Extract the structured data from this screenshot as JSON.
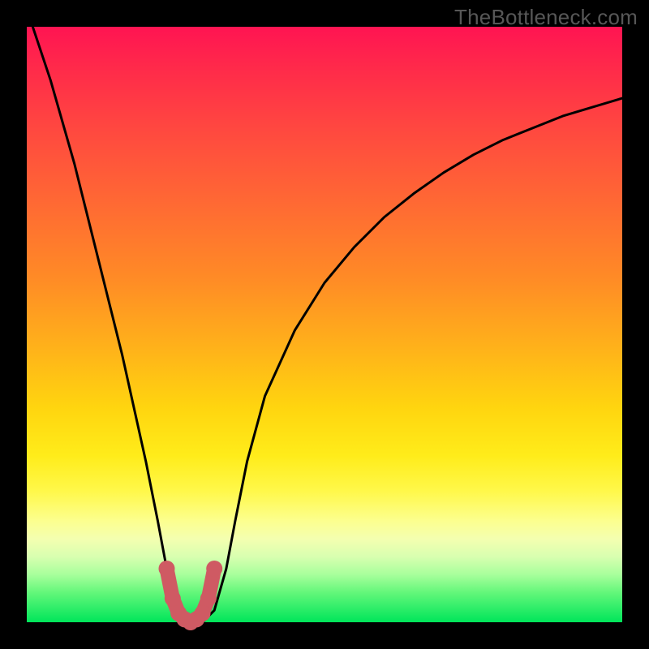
{
  "watermark": "TheBottleneck.com",
  "colors": {
    "frame_bg": "#000000",
    "curve_stroke": "#000000",
    "marker_stroke": "#cf5a63",
    "marker_fill": "#cf5a63",
    "gradient_top": "#ff1452",
    "gradient_bottom": "#00e55a"
  },
  "chart_data": {
    "type": "line",
    "title": "",
    "xlabel": "",
    "ylabel": "",
    "xlim": [
      0,
      100
    ],
    "ylim": [
      0,
      100
    ],
    "grid": false,
    "legend": false,
    "series": [
      {
        "name": "main-curve",
        "x": [
          0,
          2,
          4,
          6,
          8,
          10,
          12,
          14,
          16,
          18,
          20,
          22,
          23.5,
          25.5,
          27.5,
          29.5,
          31.5,
          33.5,
          35,
          37,
          40,
          45,
          50,
          55,
          60,
          65,
          70,
          75,
          80,
          85,
          90,
          95,
          100
        ],
        "values": [
          103,
          97,
          91,
          84,
          77,
          69,
          61,
          53,
          45,
          36,
          27,
          17,
          9,
          2,
          0,
          0,
          2,
          9,
          17,
          27,
          38,
          49,
          57,
          63,
          68,
          72,
          75.5,
          78.5,
          81,
          83,
          85,
          86.5,
          88
        ]
      },
      {
        "name": "minimum-markers",
        "x": [
          23.5,
          24.5,
          25.5,
          26.5,
          27.5,
          28.5,
          29.5,
          30.5,
          31.5
        ],
        "values": [
          9,
          4,
          1.5,
          0.5,
          0,
          0.5,
          1.5,
          4,
          9
        ]
      }
    ],
    "annotations": []
  }
}
